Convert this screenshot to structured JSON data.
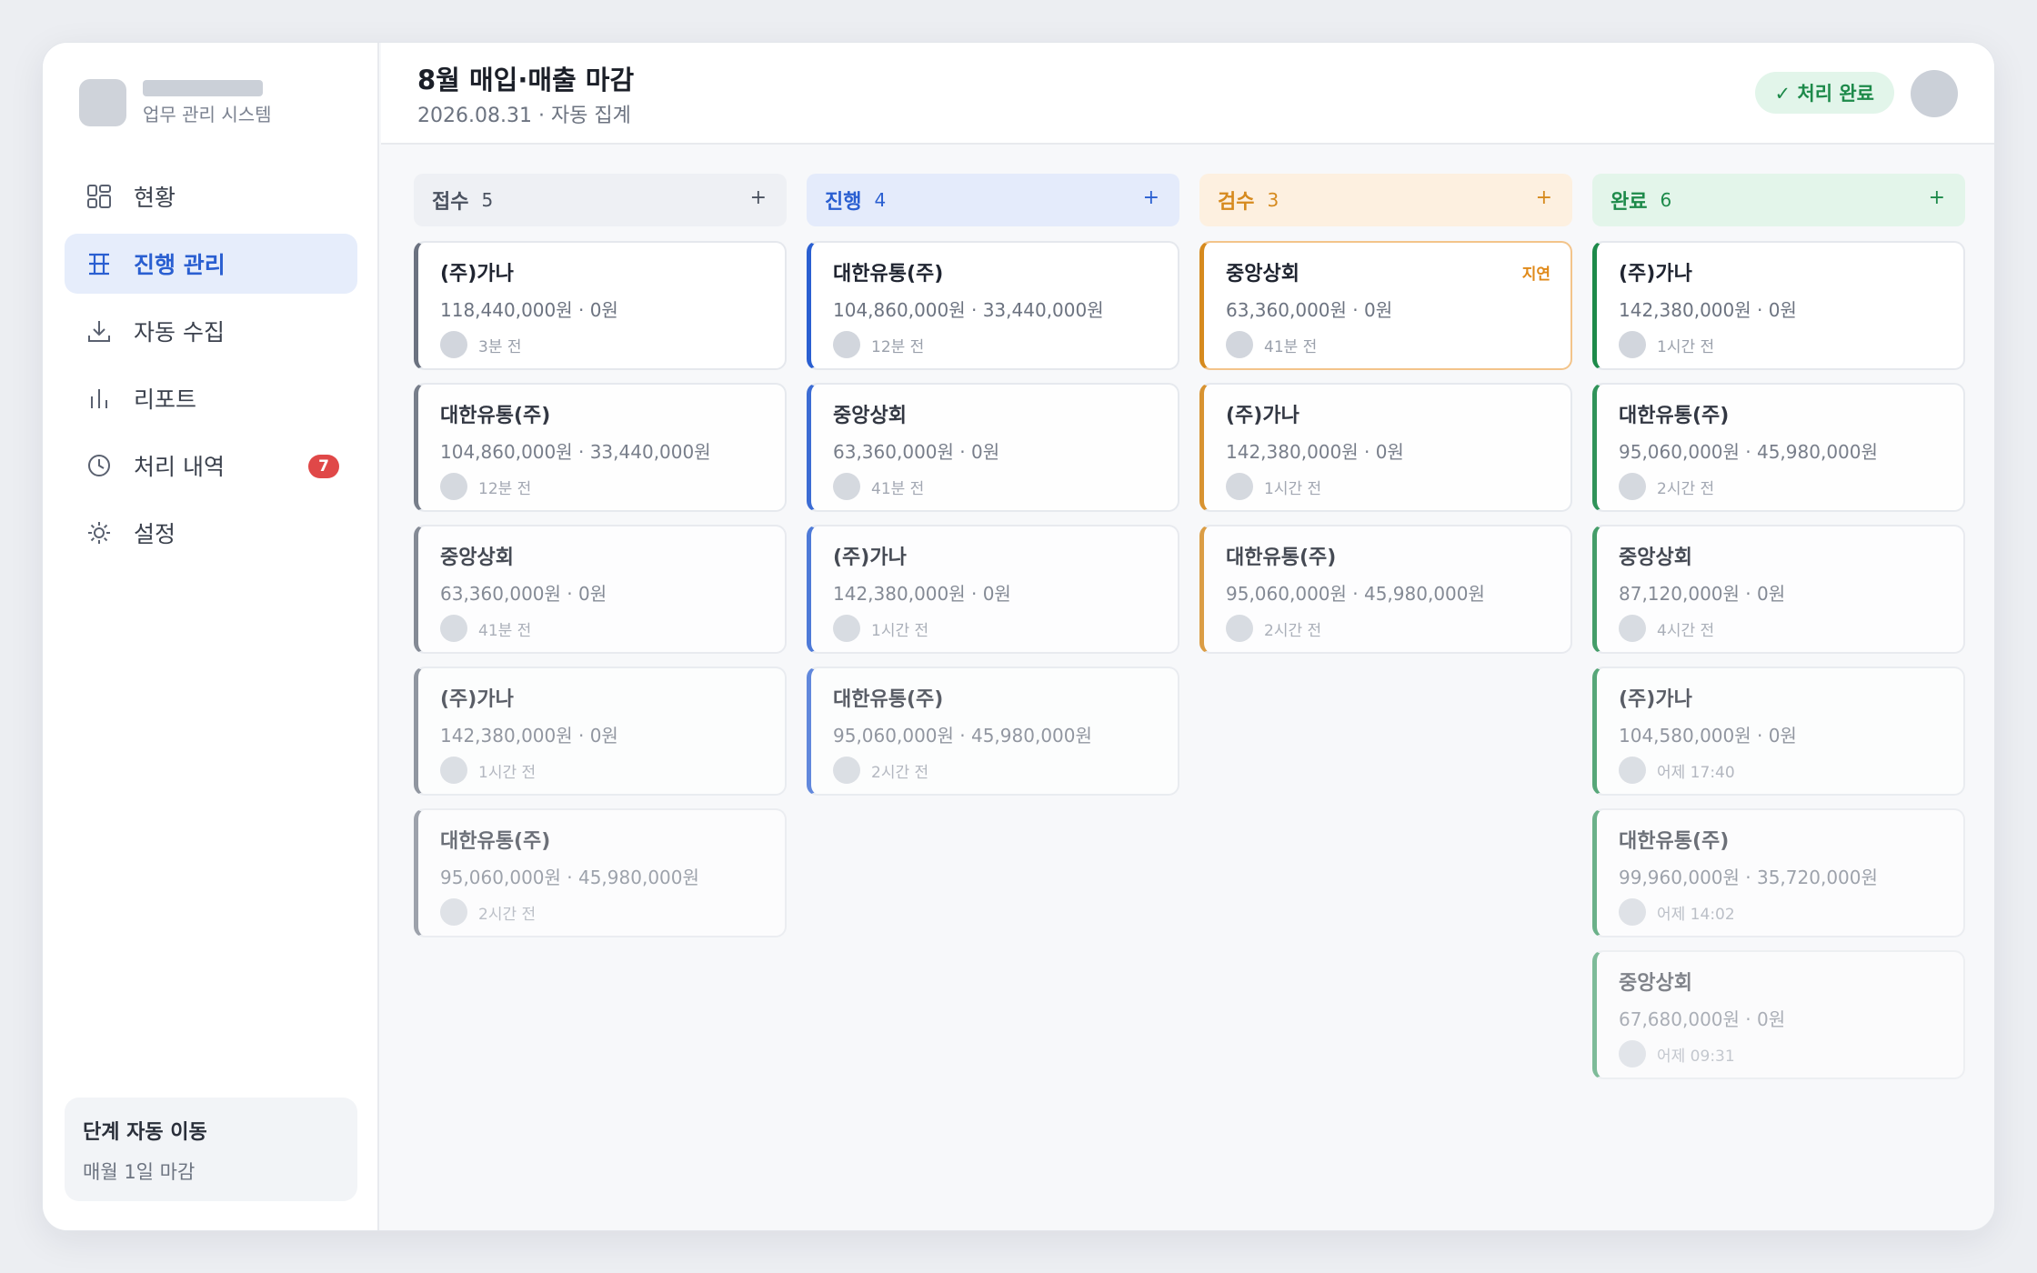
{
  "brand": {
    "subtitle": "업무 관리 시스템"
  },
  "nav": [
    {
      "label": "현황",
      "icon": "grid-icon"
    },
    {
      "label": "진행 관리",
      "icon": "kanban-icon",
      "active": true
    },
    {
      "label": "자동 수집",
      "icon": "download-icon"
    },
    {
      "label": "리포트",
      "icon": "bar-chart-icon"
    },
    {
      "label": "처리 내역",
      "icon": "clock-icon",
      "badge": "7"
    },
    {
      "label": "설정",
      "icon": "gear-icon"
    }
  ],
  "footer": {
    "title": "단계 자동 이동",
    "subtitle": "매월 1일 마감"
  },
  "header": {
    "title": "8월 매입·매출 마감",
    "subtitle": "2026.08.31 · 자동 집계",
    "status": "✓ 처리 완료"
  },
  "colors": {
    "gray": "#6b7280",
    "blue": "#2a5fd1",
    "orange": "#d68a1e",
    "green": "#1d8a4a"
  },
  "columns": [
    {
      "title": "접수",
      "count": "5",
      "add": "+",
      "cards": [
        {
          "title": "(주)가나",
          "amount": "118,440,000원 · 0원",
          "time": "3분 전"
        },
        {
          "title": "대한유통(주)",
          "amount": "104,860,000원 · 33,440,000원",
          "time": "12분 전"
        },
        {
          "title": "중앙상회",
          "amount": "63,360,000원 · 0원",
          "time": "41분 전"
        },
        {
          "title": "(주)가나",
          "amount": "142,380,000원 · 0원",
          "time": "1시간 전"
        },
        {
          "title": "대한유통(주)",
          "amount": "95,060,000원 · 45,980,000원",
          "time": "2시간 전"
        }
      ]
    },
    {
      "title": "진행",
      "count": "4",
      "add": "+",
      "cards": [
        {
          "title": "대한유통(주)",
          "amount": "104,860,000원 · 33,440,000원",
          "time": "12분 전"
        },
        {
          "title": "중앙상회",
          "amount": "63,360,000원 · 0원",
          "time": "41분 전"
        },
        {
          "title": "(주)가나",
          "amount": "142,380,000원 · 0원",
          "time": "1시간 전"
        },
        {
          "title": "대한유통(주)",
          "amount": "95,060,000원 · 45,980,000원",
          "time": "2시간 전"
        }
      ]
    },
    {
      "title": "검수",
      "count": "3",
      "add": "+",
      "cards": [
        {
          "title": "중앙상회",
          "amount": "63,360,000원 · 0원",
          "time": "41분 전",
          "flag": "지연"
        },
        {
          "title": "(주)가나",
          "amount": "142,380,000원 · 0원",
          "time": "1시간 전"
        },
        {
          "title": "대한유통(주)",
          "amount": "95,060,000원 · 45,980,000원",
          "time": "2시간 전"
        }
      ]
    },
    {
      "title": "완료",
      "count": "6",
      "add": "+",
      "cards": [
        {
          "title": "(주)가나",
          "amount": "142,380,000원 · 0원",
          "time": "1시간 전"
        },
        {
          "title": "대한유통(주)",
          "amount": "95,060,000원 · 45,980,000원",
          "time": "2시간 전"
        },
        {
          "title": "중앙상회",
          "amount": "87,120,000원 · 0원",
          "time": "4시간 전"
        },
        {
          "title": "(주)가나",
          "amount": "104,580,000원 · 0원",
          "time": "어제 17:40"
        },
        {
          "title": "대한유통(주)",
          "amount": "99,960,000원 · 35,720,000원",
          "time": "어제 14:02"
        },
        {
          "title": "중앙상회",
          "amount": "67,680,000원 · 0원",
          "time": "어제 09:31"
        }
      ]
    }
  ]
}
